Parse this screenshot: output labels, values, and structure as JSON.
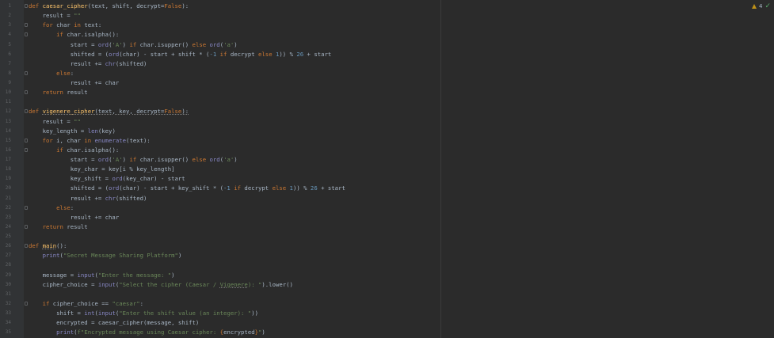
{
  "inspection": {
    "warning_count": "4",
    "status_icon": "check-icon"
  },
  "colors": {
    "background": "#2b2b2b",
    "gutter": "#313335",
    "keyword": "#cc7832",
    "function": "#ffc66d",
    "builtin": "#8888c6",
    "string": "#6a8759",
    "number": "#6897bb",
    "text": "#a9b7c6"
  },
  "lines": [
    {
      "n": "1",
      "fold": true,
      "tokens": [
        [
          "kw",
          "def "
        ],
        [
          "fn",
          "caesar_cipher"
        ],
        [
          "tx",
          "(text, shift, decrypt="
        ],
        [
          "kw",
          "False"
        ],
        [
          "tx",
          "):"
        ]
      ]
    },
    {
      "n": "2",
      "tokens": [
        [
          "tx",
          "    result = "
        ],
        [
          "str",
          "\"\""
        ]
      ]
    },
    {
      "n": "3",
      "fold": true,
      "tokens": [
        [
          "tx",
          "    "
        ],
        [
          "kw",
          "for "
        ],
        [
          "tx",
          "char "
        ],
        [
          "kw",
          "in "
        ],
        [
          "tx",
          "text:"
        ]
      ]
    },
    {
      "n": "4",
      "fold": true,
      "tokens": [
        [
          "tx",
          "        "
        ],
        [
          "kw",
          "if "
        ],
        [
          "tx",
          "char.isalpha():"
        ]
      ]
    },
    {
      "n": "5",
      "tokens": [
        [
          "tx",
          "            start = "
        ],
        [
          "bi",
          "ord"
        ],
        [
          "tx",
          "("
        ],
        [
          "str",
          "'A'"
        ],
        [
          "tx",
          ") "
        ],
        [
          "kw",
          "if "
        ],
        [
          "tx",
          "char.isupper() "
        ],
        [
          "kw",
          "else "
        ],
        [
          "bi",
          "ord"
        ],
        [
          "tx",
          "("
        ],
        [
          "str",
          "'a'"
        ],
        [
          "tx",
          ")"
        ]
      ]
    },
    {
      "n": "6",
      "tokens": [
        [
          "tx",
          "            shifted = ("
        ],
        [
          "bi",
          "ord"
        ],
        [
          "tx",
          "(char) - start + shift * ("
        ],
        [
          "num",
          "-1"
        ],
        [
          "tx",
          " "
        ],
        [
          "kw",
          "if "
        ],
        [
          "tx",
          "decrypt "
        ],
        [
          "kw",
          "else "
        ],
        [
          "num",
          "1"
        ],
        [
          "tx",
          ")) % "
        ],
        [
          "num",
          "26"
        ],
        [
          "tx",
          " + start"
        ]
      ]
    },
    {
      "n": "7",
      "tokens": [
        [
          "tx",
          "            result += "
        ],
        [
          "bi",
          "chr"
        ],
        [
          "tx",
          "(shifted)"
        ]
      ]
    },
    {
      "n": "8",
      "fold": true,
      "tokens": [
        [
          "tx",
          "        "
        ],
        [
          "kw",
          "else"
        ],
        [
          "tx",
          ":"
        ]
      ]
    },
    {
      "n": "9",
      "tokens": [
        [
          "tx",
          "            result += char"
        ]
      ]
    },
    {
      "n": "10",
      "fold": true,
      "tokens": [
        [
          "tx",
          "    "
        ],
        [
          "kw",
          "return "
        ],
        [
          "tx",
          "result"
        ]
      ]
    },
    {
      "n": "11",
      "tokens": []
    },
    {
      "n": "12",
      "fold": true,
      "tokens": [
        [
          "kw",
          "def "
        ],
        [
          "fn sq",
          "vigenere_cipher"
        ],
        [
          "tx sq",
          "(text, key, decrypt="
        ],
        [
          "kw sq",
          "False"
        ],
        [
          "tx sq",
          "):"
        ]
      ]
    },
    {
      "n": "13",
      "tokens": [
        [
          "tx",
          "    result = "
        ],
        [
          "str",
          "\"\""
        ]
      ]
    },
    {
      "n": "14",
      "tokens": [
        [
          "tx",
          "    key_length = "
        ],
        [
          "bi",
          "len"
        ],
        [
          "tx",
          "(key)"
        ]
      ]
    },
    {
      "n": "15",
      "fold": true,
      "tokens": [
        [
          "tx",
          "    "
        ],
        [
          "kw",
          "for "
        ],
        [
          "tx",
          "i, char "
        ],
        [
          "kw",
          "in "
        ],
        [
          "bi",
          "enumerate"
        ],
        [
          "tx",
          "(text):"
        ]
      ]
    },
    {
      "n": "16",
      "fold": true,
      "tokens": [
        [
          "tx",
          "        "
        ],
        [
          "kw",
          "if "
        ],
        [
          "tx",
          "char.isalpha():"
        ]
      ]
    },
    {
      "n": "17",
      "tokens": [
        [
          "tx",
          "            start = "
        ],
        [
          "bi",
          "ord"
        ],
        [
          "tx",
          "("
        ],
        [
          "str",
          "'A'"
        ],
        [
          "tx",
          ") "
        ],
        [
          "kw",
          "if "
        ],
        [
          "tx",
          "char.isupper() "
        ],
        [
          "kw",
          "else "
        ],
        [
          "bi",
          "ord"
        ],
        [
          "tx",
          "("
        ],
        [
          "str",
          "'a'"
        ],
        [
          "tx",
          ")"
        ]
      ]
    },
    {
      "n": "18",
      "tokens": [
        [
          "tx",
          "            key_char = key[i % key_length]"
        ]
      ]
    },
    {
      "n": "19",
      "tokens": [
        [
          "tx",
          "            key_shift = "
        ],
        [
          "bi",
          "ord"
        ],
        [
          "tx",
          "(key_char) - start"
        ]
      ]
    },
    {
      "n": "20",
      "tokens": [
        [
          "tx",
          "            shifted = ("
        ],
        [
          "bi",
          "ord"
        ],
        [
          "tx",
          "(char) - start + key_shift * ("
        ],
        [
          "num",
          "-1"
        ],
        [
          "tx",
          " "
        ],
        [
          "kw",
          "if "
        ],
        [
          "tx",
          "decrypt "
        ],
        [
          "kw",
          "else "
        ],
        [
          "num",
          "1"
        ],
        [
          "tx",
          ")) % "
        ],
        [
          "num",
          "26"
        ],
        [
          "tx",
          " + start"
        ]
      ]
    },
    {
      "n": "21",
      "tokens": [
        [
          "tx",
          "            result += "
        ],
        [
          "bi",
          "chr"
        ],
        [
          "tx",
          "(shifted)"
        ]
      ]
    },
    {
      "n": "22",
      "fold": true,
      "tokens": [
        [
          "tx",
          "        "
        ],
        [
          "kw",
          "else"
        ],
        [
          "tx",
          ":"
        ]
      ]
    },
    {
      "n": "23",
      "tokens": [
        [
          "tx",
          "            result += char"
        ]
      ]
    },
    {
      "n": "24",
      "fold": true,
      "tokens": [
        [
          "tx",
          "    "
        ],
        [
          "kw",
          "return "
        ],
        [
          "tx",
          "result"
        ]
      ]
    },
    {
      "n": "25",
      "tokens": []
    },
    {
      "n": "26",
      "fold": true,
      "tokens": [
        [
          "kw",
          "def "
        ],
        [
          "fn sq",
          "main"
        ],
        [
          "tx",
          "():"
        ]
      ]
    },
    {
      "n": "27",
      "tokens": [
        [
          "tx",
          "    "
        ],
        [
          "bi",
          "print"
        ],
        [
          "tx",
          "("
        ],
        [
          "str",
          "\"Secret Message Sharing Platform\""
        ],
        [
          "tx",
          ")"
        ]
      ]
    },
    {
      "n": "28",
      "tokens": []
    },
    {
      "n": "29",
      "tokens": [
        [
          "tx",
          "    message = "
        ],
        [
          "bi",
          "input"
        ],
        [
          "tx",
          "("
        ],
        [
          "str",
          "\"Enter the message: \""
        ],
        [
          "tx",
          ")"
        ]
      ]
    },
    {
      "n": "30",
      "tokens": [
        [
          "tx",
          "    cipher_choice = "
        ],
        [
          "bi",
          "input"
        ],
        [
          "tx",
          "("
        ],
        [
          "str",
          "\"Select the cipher (Caesar / "
        ],
        [
          "str sq",
          "Vigenere"
        ],
        [
          "str",
          "): \""
        ],
        [
          "tx",
          ").lower()"
        ]
      ]
    },
    {
      "n": "31",
      "tokens": []
    },
    {
      "n": "32",
      "fold": true,
      "tokens": [
        [
          "tx",
          "    "
        ],
        [
          "kw",
          "if "
        ],
        [
          "tx",
          "cipher_choice == "
        ],
        [
          "str",
          "\"caesar\""
        ],
        [
          "tx",
          ":"
        ]
      ]
    },
    {
      "n": "33",
      "tokens": [
        [
          "tx",
          "        shift = "
        ],
        [
          "bi",
          "int"
        ],
        [
          "tx",
          "("
        ],
        [
          "bi",
          "input"
        ],
        [
          "tx",
          "("
        ],
        [
          "str",
          "\"Enter the shift value (an integer): \""
        ],
        [
          "tx",
          "))"
        ]
      ]
    },
    {
      "n": "34",
      "tokens": [
        [
          "tx",
          "        encrypted = caesar_cipher(message, shift)"
        ]
      ]
    },
    {
      "n": "35",
      "tokens": [
        [
          "tx",
          "        "
        ],
        [
          "bi",
          "print"
        ],
        [
          "tx",
          "("
        ],
        [
          "str",
          "f\"Encrypted message using Caesar cipher: "
        ],
        [
          "kw",
          "{"
        ],
        [
          "tx",
          "encrypted"
        ],
        [
          "kw",
          "}"
        ],
        [
          "str",
          "\""
        ],
        [
          "tx",
          ")"
        ]
      ]
    }
  ]
}
